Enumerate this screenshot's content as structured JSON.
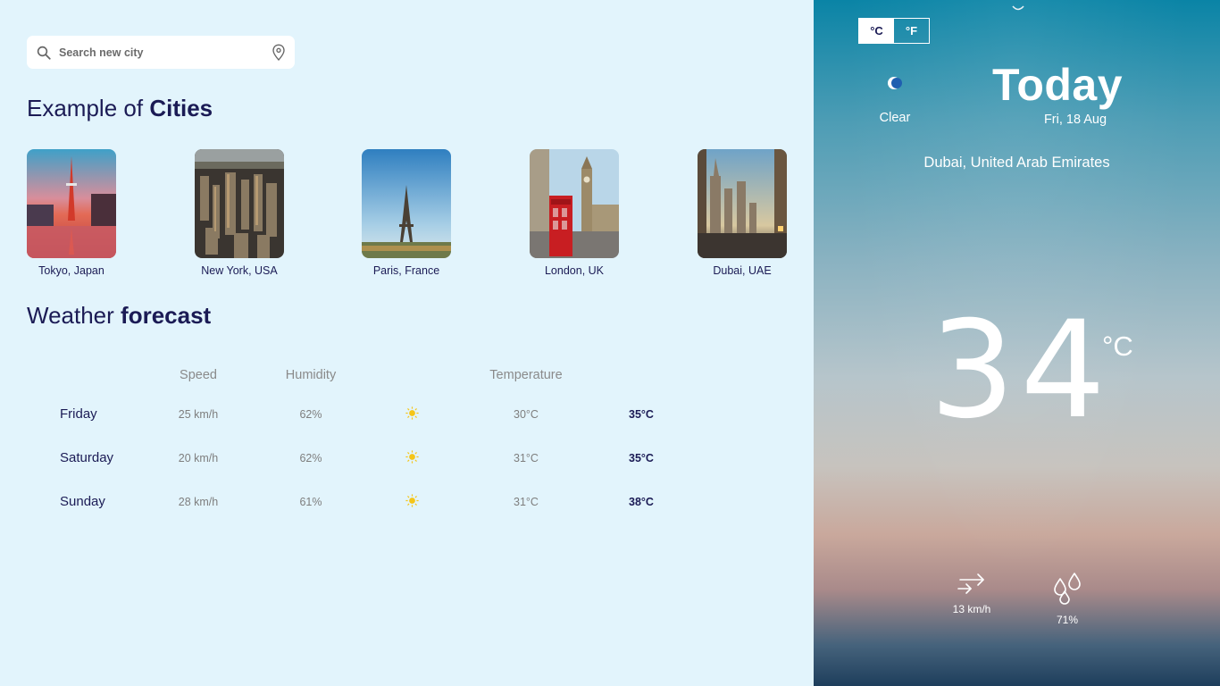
{
  "search": {
    "placeholder": "Search new city",
    "icon": "search-icon",
    "location_icon": "location-pin-icon"
  },
  "cities_heading": {
    "prefix": "Example of",
    "bold": "Cities"
  },
  "cities": [
    {
      "name": "Tokyo, Japan"
    },
    {
      "name": "New York, USA"
    },
    {
      "name": "Paris, France"
    },
    {
      "name": "London, UK"
    },
    {
      "name": "Dubai, UAE"
    }
  ],
  "forecast_heading": {
    "prefix": "Weather",
    "bold": "forecast"
  },
  "forecast": {
    "columns": {
      "speed": "Speed",
      "humidity": "Humidity",
      "temperature": "Temperature"
    },
    "rows": [
      {
        "day": "Friday",
        "speed": "25 km/h",
        "humidity": "62%",
        "icon": "sun-icon",
        "min": "30°C",
        "max": "35°C"
      },
      {
        "day": "Saturday",
        "speed": "20 km/h",
        "humidity": "62%",
        "icon": "sun-icon",
        "min": "31°C",
        "max": "35°C"
      },
      {
        "day": "Sunday",
        "speed": "28 km/h",
        "humidity": "61%",
        "icon": "sun-icon",
        "min": "31°C",
        "max": "38°C"
      }
    ]
  },
  "current": {
    "units": {
      "celsius": "°C",
      "fahrenheit": "°F",
      "selected": "celsius"
    },
    "condition": "Clear",
    "condition_icon": "moon-icon",
    "today_label": "Today",
    "date": "Fri, 18 Aug",
    "location": "Dubai, United Arab Emirates",
    "temperature": "34",
    "temperature_unit": "°C",
    "wind": "13 km/h",
    "wind_icon": "wind-arrows-icon",
    "humidity": "71%",
    "humidity_icon": "droplets-icon"
  },
  "colors": {
    "navy": "#1b1b55",
    "panel_bg": "#e2f4fc",
    "sun": "#f5c518"
  }
}
